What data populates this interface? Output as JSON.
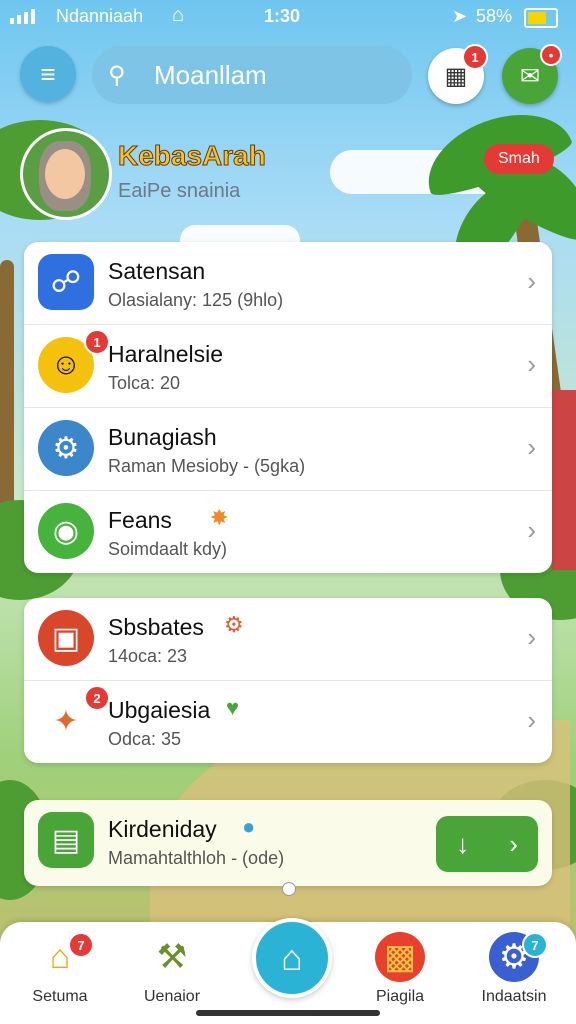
{
  "status_bar": {
    "carrier": "Ndanniaah",
    "time": "1:30",
    "battery": "58%"
  },
  "header": {
    "search_placeholder": "Moanllam",
    "inbox_badge": "1",
    "chat_badge": "•"
  },
  "profile": {
    "name": "KebasArah",
    "subtitle": "EaiPe snainia",
    "pill_label": "Smah"
  },
  "card_main": [
    {
      "title": "Satensan",
      "subtitle": "Olasialany: 125 (9hlo)",
      "icon": "link-icon",
      "color": "#2f6fe0",
      "badge": ""
    },
    {
      "title": "Haralnelsie",
      "subtitle": "Tolca: 20",
      "icon": "smiley-icon",
      "color": "#f4c20d",
      "badge": "1"
    },
    {
      "title": "Bunagiash",
      "subtitle": "Raman Mesioby - (5gka)",
      "icon": "robot-icon",
      "color": "#3b87c9",
      "badge": ""
    },
    {
      "title": "Feans",
      "subtitle": "Soimdaalt kdy)",
      "icon": "chat-icon",
      "color": "#46b43c",
      "badge": ""
    }
  ],
  "card_second": [
    {
      "title": "Sbsbates",
      "subtitle": "14oca: 23",
      "icon": "tv-icon",
      "color": "#d9472b",
      "badge": ""
    },
    {
      "title": "Ubgaiesia",
      "subtitle": "Odca: 35",
      "icon": "carrot-icon",
      "color": "#ffffff",
      "badge": "2"
    }
  ],
  "card_third": {
    "title": "Kirdeniday",
    "subtitle": "Mamahtalthloh - (ode)"
  },
  "nav": [
    {
      "label": "Setuma",
      "icon": "house-icon",
      "badge": "7"
    },
    {
      "label": "Uenaior",
      "icon": "tools-icon",
      "badge": ""
    },
    {
      "label": "Piagila",
      "icon": "food-icon",
      "badge": ""
    },
    {
      "label": "Indaatsin",
      "icon": "gear-icon",
      "badge": "7"
    }
  ],
  "colors": {
    "accent_green": "#4aa538",
    "badge_red": "#e53935",
    "home_blue": "#2bb3d6"
  }
}
